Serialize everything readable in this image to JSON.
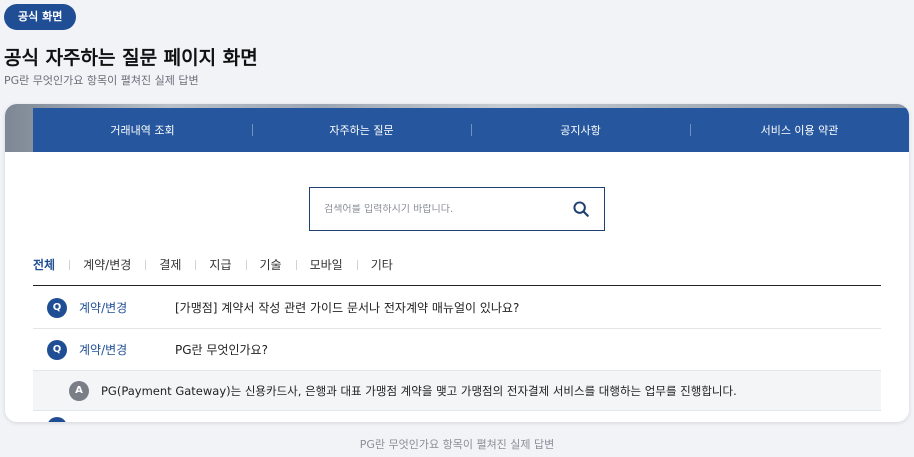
{
  "badge": "공식 화면",
  "page_title": "공식 자주하는 질문 페이지 화면",
  "page_subtitle": "PG란 무엇인가요 항목이 펼쳐진 실제 답변",
  "nav": {
    "items": [
      {
        "label": "거래내역 조회"
      },
      {
        "label": "자주하는 질문"
      },
      {
        "label": "공지사항"
      },
      {
        "label": "서비스 이용 약관"
      }
    ]
  },
  "search": {
    "placeholder": "검색어를 입력하시기 바랍니다.",
    "value": "",
    "icon": "search-icon"
  },
  "tabs": [
    {
      "label": "전체",
      "active": true
    },
    {
      "label": "계약/변경"
    },
    {
      "label": "결제"
    },
    {
      "label": "지급"
    },
    {
      "label": "기술"
    },
    {
      "label": "모바일"
    },
    {
      "label": "기타"
    }
  ],
  "faq": {
    "q_marker": "Q",
    "a_marker": "A",
    "items": [
      {
        "category": "계약/변경",
        "question": "[가맹점] 계약서 작성 관련 가이드 문서나 전자계약 매뉴얼이 있나요?"
      },
      {
        "category": "계약/변경",
        "question": "PG란 무엇인가요?",
        "answer": "PG(Payment Gateway)는 신용카드사, 은행과 대표 가맹점 계약을 맺고 가맹점의 전자결제 서비스를 대행하는 업무를 진행합니다."
      }
    ]
  },
  "footer_caption": "PG란 무엇인가요 항목이 펼쳐진 실제 답변",
  "colors": {
    "brand": "#1f4e95",
    "nav_bg": "#26579e",
    "answer_bg": "#f4f5f7"
  }
}
